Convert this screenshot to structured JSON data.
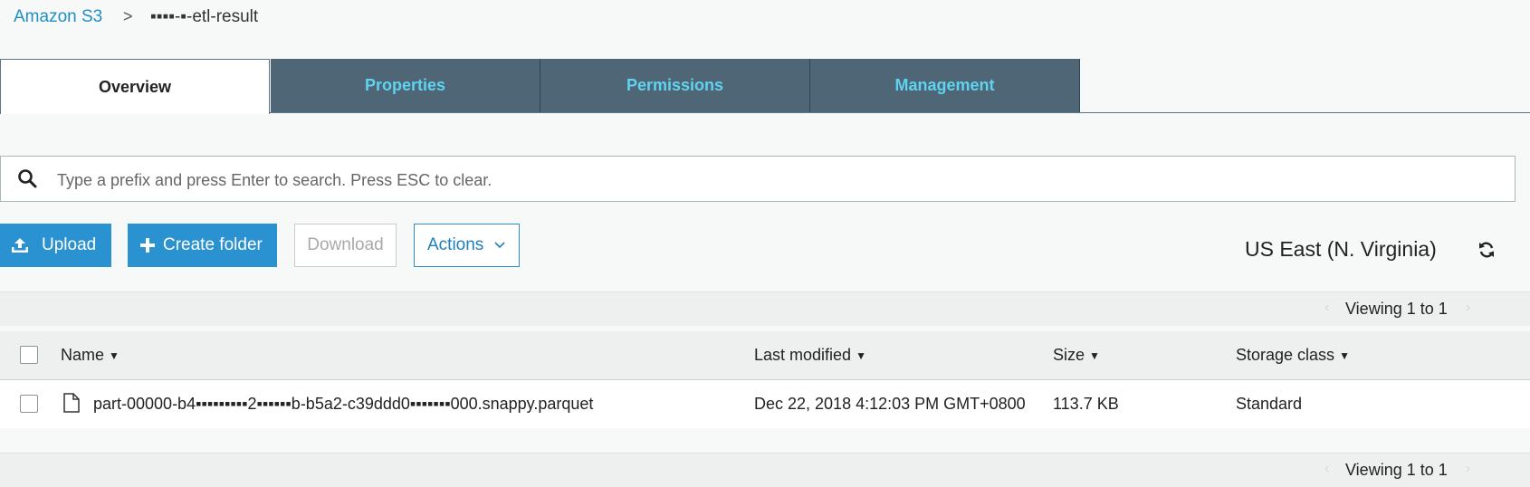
{
  "breadcrumb": {
    "home": "Amazon S3",
    "separator": ">",
    "bucket": "▪▪▪▪-▪-etl-result"
  },
  "tabs": [
    {
      "label": "Overview",
      "active": true
    },
    {
      "label": "Properties",
      "active": false
    },
    {
      "label": "Permissions",
      "active": false
    },
    {
      "label": "Management",
      "active": false
    }
  ],
  "search": {
    "value": "",
    "placeholder": "Type a prefix and press Enter to search. Press ESC to clear."
  },
  "toolbar": {
    "upload": "Upload",
    "create_folder": "Create folder",
    "download": "Download",
    "actions": "Actions"
  },
  "region": "US East (N. Virginia)",
  "pagination": {
    "top": "Viewing 1 to 1",
    "bottom": "Viewing 1 to 1"
  },
  "table": {
    "columns": [
      "Name",
      "Last modified",
      "Size",
      "Storage class"
    ],
    "rows": [
      {
        "name": "part-00000-b4▪▪▪▪▪▪▪▪▪2▪▪▪▪▪▪b-b5a2-c39ddd0▪▪▪▪▪▪▪000.snappy.parquet",
        "last_modified": "Dec 22, 2018 4:12:03 PM GMT+0800",
        "size": "113.7 KB",
        "storage_class": "Standard"
      }
    ]
  },
  "colors": {
    "accent": "#2a92d1",
    "tab_bg": "#4e6675",
    "tab_text": "#5fd3f0",
    "link": "#1e8fc6"
  }
}
